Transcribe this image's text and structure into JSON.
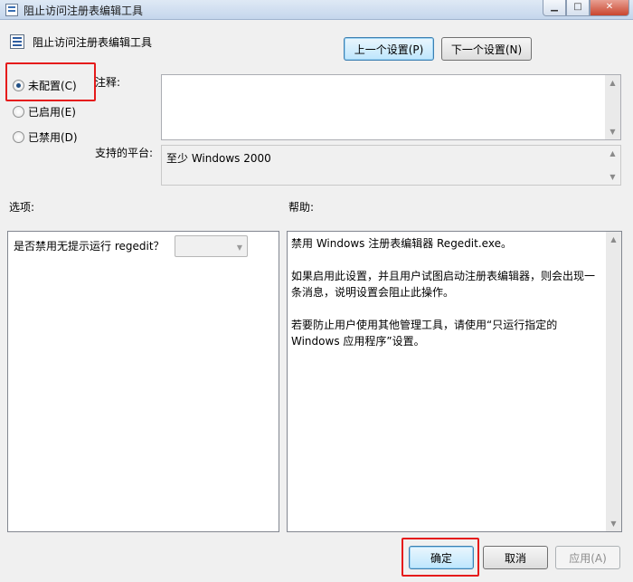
{
  "window": {
    "title": "阻止访问注册表编辑工具",
    "controls": {
      "minimize": "▁",
      "maximize": "□",
      "close": "✕"
    }
  },
  "header": {
    "policy_name": "阻止访问注册表编辑工具"
  },
  "nav": {
    "prev_label": "上一个设置(P)",
    "next_label": "下一个设置(N)"
  },
  "state": {
    "not_configured": "未配置(C)",
    "enabled": "已启用(E)",
    "disabled": "已禁用(D)",
    "selected": "not_configured"
  },
  "comment": {
    "label": "注释:",
    "value": ""
  },
  "platform": {
    "label": "支持的平台:",
    "value": "至少 Windows 2000"
  },
  "options": {
    "label": "选项:",
    "item_label": "是否禁用无提示运行 regedit？",
    "combo_value": ""
  },
  "help": {
    "label": "帮助:",
    "paragraphs": [
      "禁用 Windows 注册表编辑器 Regedit.exe。",
      "如果启用此设置，并且用户试图启动注册表编辑器，则会出现一条消息，说明设置会阻止此操作。",
      "若要防止用户使用其他管理工具，请使用“只运行指定的 Windows 应用程序”设置。"
    ]
  },
  "footer": {
    "ok_label": "确定",
    "cancel_label": "取消",
    "apply_label": "应用(A)"
  },
  "colors": {
    "highlight": "#e51b1b",
    "titlebar": "#c4d6ec"
  },
  "icons": {
    "title": "policy-icon",
    "header": "policy-icon"
  }
}
